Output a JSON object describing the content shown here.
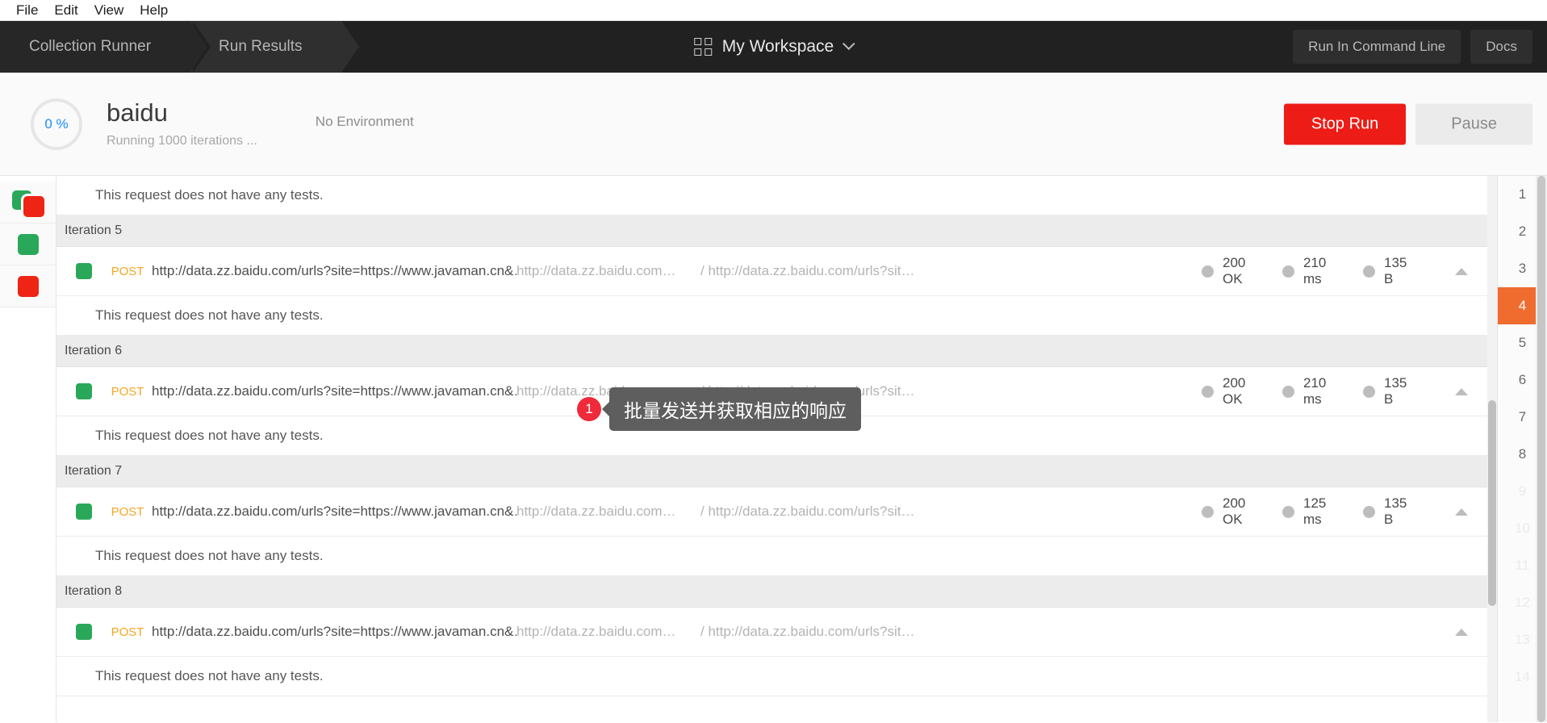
{
  "menubar": {
    "items": [
      "File",
      "Edit",
      "View",
      "Help"
    ]
  },
  "navbar": {
    "tabs": [
      {
        "label": "Collection Runner",
        "active": false
      },
      {
        "label": "Run Results",
        "active": true
      }
    ],
    "workspace": {
      "icon": "grid-icon",
      "name": "My Workspace",
      "chevron": "chevron-down-icon"
    },
    "buttons": [
      {
        "label": "Run In Command Line"
      },
      {
        "label": "Docs"
      }
    ]
  },
  "run_header": {
    "progress": "0 %",
    "title": "baidu",
    "subtitle": "Running 1000 iterations ...",
    "environment": "No Environment",
    "stop_label": "Stop Run",
    "pause_label": "Pause"
  },
  "left_filters": [
    {
      "name": "filter-all",
      "icon": "green-red-squares-icon"
    },
    {
      "name": "filter-passed",
      "icon": "green-square-icon"
    },
    {
      "name": "filter-failed",
      "icon": "red-square-icon"
    }
  ],
  "annotation": {
    "badge": "1",
    "text": "批量发送并获取相应的响应"
  },
  "results": {
    "no_tests_text": "This request does not have any tests.",
    "rows": [
      {
        "type": "notests",
        "text": "This request does not have any tests."
      },
      {
        "type": "iteration",
        "label": "Iteration 5"
      },
      {
        "type": "request",
        "method": "POST",
        "name": "http://data.zz.baidu.com/urls?site=https://www.javaman.cn&…",
        "url1": "http://data.zz.baidu.com…",
        "url2": "/ http://data.zz.baidu.com/urls?sit…",
        "status_code": "200",
        "status_text": "OK",
        "time_value": "210",
        "time_unit": "ms",
        "size_value": "135",
        "size_unit": "B",
        "has_stats": true
      },
      {
        "type": "notests",
        "text": "This request does not have any tests."
      },
      {
        "type": "iteration",
        "label": "Iteration 6"
      },
      {
        "type": "request",
        "method": "POST",
        "name": "http://data.zz.baidu.com/urls?site=https://www.javaman.cn&…",
        "url1": "http://data.zz.baidu.com…",
        "url2": "/ http://data.zz.baidu.com/urls?sit…",
        "status_code": "200",
        "status_text": "OK",
        "time_value": "210",
        "time_unit": "ms",
        "size_value": "135",
        "size_unit": "B",
        "has_stats": true
      },
      {
        "type": "notests",
        "text": "This request does not have any tests."
      },
      {
        "type": "iteration",
        "label": "Iteration 7"
      },
      {
        "type": "request",
        "method": "POST",
        "name": "http://data.zz.baidu.com/urls?site=https://www.javaman.cn&…",
        "url1": "http://data.zz.baidu.com…",
        "url2": "/ http://data.zz.baidu.com/urls?sit…",
        "status_code": "200",
        "status_text": "OK",
        "time_value": "125",
        "time_unit": "ms",
        "size_value": "135",
        "size_unit": "B",
        "has_stats": true
      },
      {
        "type": "notests",
        "text": "This request does not have any tests."
      },
      {
        "type": "iteration",
        "label": "Iteration 8"
      },
      {
        "type": "request",
        "method": "POST",
        "name": "http://data.zz.baidu.com/urls?site=https://www.javaman.cn&…",
        "url1": "http://data.zz.baidu.com…",
        "url2": "/ http://data.zz.baidu.com/urls?sit…",
        "status_code": "",
        "status_text": "",
        "time_value": "",
        "time_unit": "",
        "size_value": "",
        "size_unit": "",
        "has_stats": false
      },
      {
        "type": "notests",
        "text": "This request does not have any tests."
      }
    ]
  },
  "iteration_nav": {
    "active": 4,
    "items": [
      {
        "label": "1",
        "faded": false
      },
      {
        "label": "2",
        "faded": false
      },
      {
        "label": "3",
        "faded": false
      },
      {
        "label": "4",
        "faded": false
      },
      {
        "label": "5",
        "faded": false
      },
      {
        "label": "6",
        "faded": false
      },
      {
        "label": "7",
        "faded": false
      },
      {
        "label": "8",
        "faded": false
      },
      {
        "label": "9",
        "faded": true
      },
      {
        "label": "10",
        "faded": true
      },
      {
        "label": "11",
        "faded": true
      },
      {
        "label": "12",
        "faded": true
      },
      {
        "label": "13",
        "faded": true
      },
      {
        "label": "14",
        "faded": true
      }
    ]
  },
  "colors": {
    "accent_orange": "#ef6c2e",
    "stop_red": "#ed1c16",
    "method_orange": "#f5a623",
    "pass_green": "#2aa85a",
    "fail_red": "#ee2414",
    "progress_blue": "#1a8cff",
    "navbar_dark": "#212121"
  }
}
